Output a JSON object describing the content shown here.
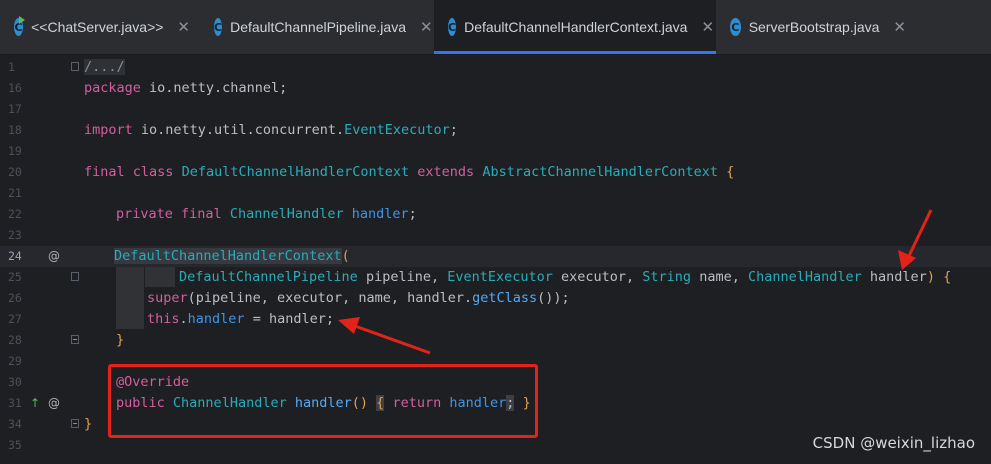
{
  "tabs": [
    {
      "label": "<<ChatServer.java>>",
      "icon": "java-class-run-icon",
      "active": false
    },
    {
      "label": "DefaultChannelPipeline.java",
      "icon": "java-class-icon",
      "active": false
    },
    {
      "label": "DefaultChannelHandlerContext.java",
      "icon": "java-class-icon",
      "active": true
    },
    {
      "label": "ServerBootstrap.java",
      "icon": "java-class-icon",
      "active": false
    }
  ],
  "tab_close_glyph": "✕",
  "tab_icon_letter": "C",
  "editor": {
    "line_numbers": [
      "1",
      "16",
      "17",
      "18",
      "19",
      "20",
      "21",
      "22",
      "23",
      "24",
      "25",
      "26",
      "27",
      "28",
      "29",
      "30",
      "31",
      "34",
      "35"
    ],
    "gutter_marks": {
      "line24": "@",
      "line31_override": "↑",
      "line31_at": "@"
    },
    "lines": {
      "l1": "/.../",
      "l16_kw": "package",
      "l16_rest": " io.netty.channel;",
      "l18_kw": "import",
      "l18_pkg": " io.netty.util.concurrent.",
      "l18_cls": "EventExecutor",
      "l18_end": ";",
      "l20_kw1": "final",
      "l20_kw2": "class",
      "l20_cls": "DefaultChannelHandlerContext",
      "l20_kw3": "extends",
      "l20_sup": "AbstractChannelHandlerContext",
      "l20_brace": "{",
      "l22_kw1": "private",
      "l22_kw2": "final",
      "l22_type": "ChannelHandler",
      "l22_field": "handler",
      "l22_end": ";",
      "l24_ctor": "DefaultChannelHandlerContext",
      "l24_paren": "(",
      "l25_t1": "DefaultChannelPipeline",
      "l25_p1": " pipeline, ",
      "l25_t2": "EventExecutor",
      "l25_p2": " executor, ",
      "l25_t3": "String",
      "l25_p3": " name, ",
      "l25_t4": "ChannelHandler",
      "l25_p4": " handler",
      "l25_end": ") ",
      "l25_brace": "{",
      "l26_kw": "super",
      "l26_rest": "(pipeline, executor, name, handler.",
      "l26_fn": "getClass",
      "l26_end": "());",
      "l27_kw": "this",
      "l27_dot": ".",
      "l27_field": "handler",
      "l27_rest": " = handler;",
      "l28": "}",
      "l30": "@Override",
      "l31_kw": "public",
      "l31_type": "ChannelHandler",
      "l31_fn": "handler",
      "l31_paren": "()",
      "l31_ob": "{",
      "l31_ret": "return",
      "l31_field": "handler",
      "l31_semi": ";",
      "l31_cb": "}",
      "l34": "}"
    }
  },
  "watermark": "CSDN @weixin_lizhao"
}
